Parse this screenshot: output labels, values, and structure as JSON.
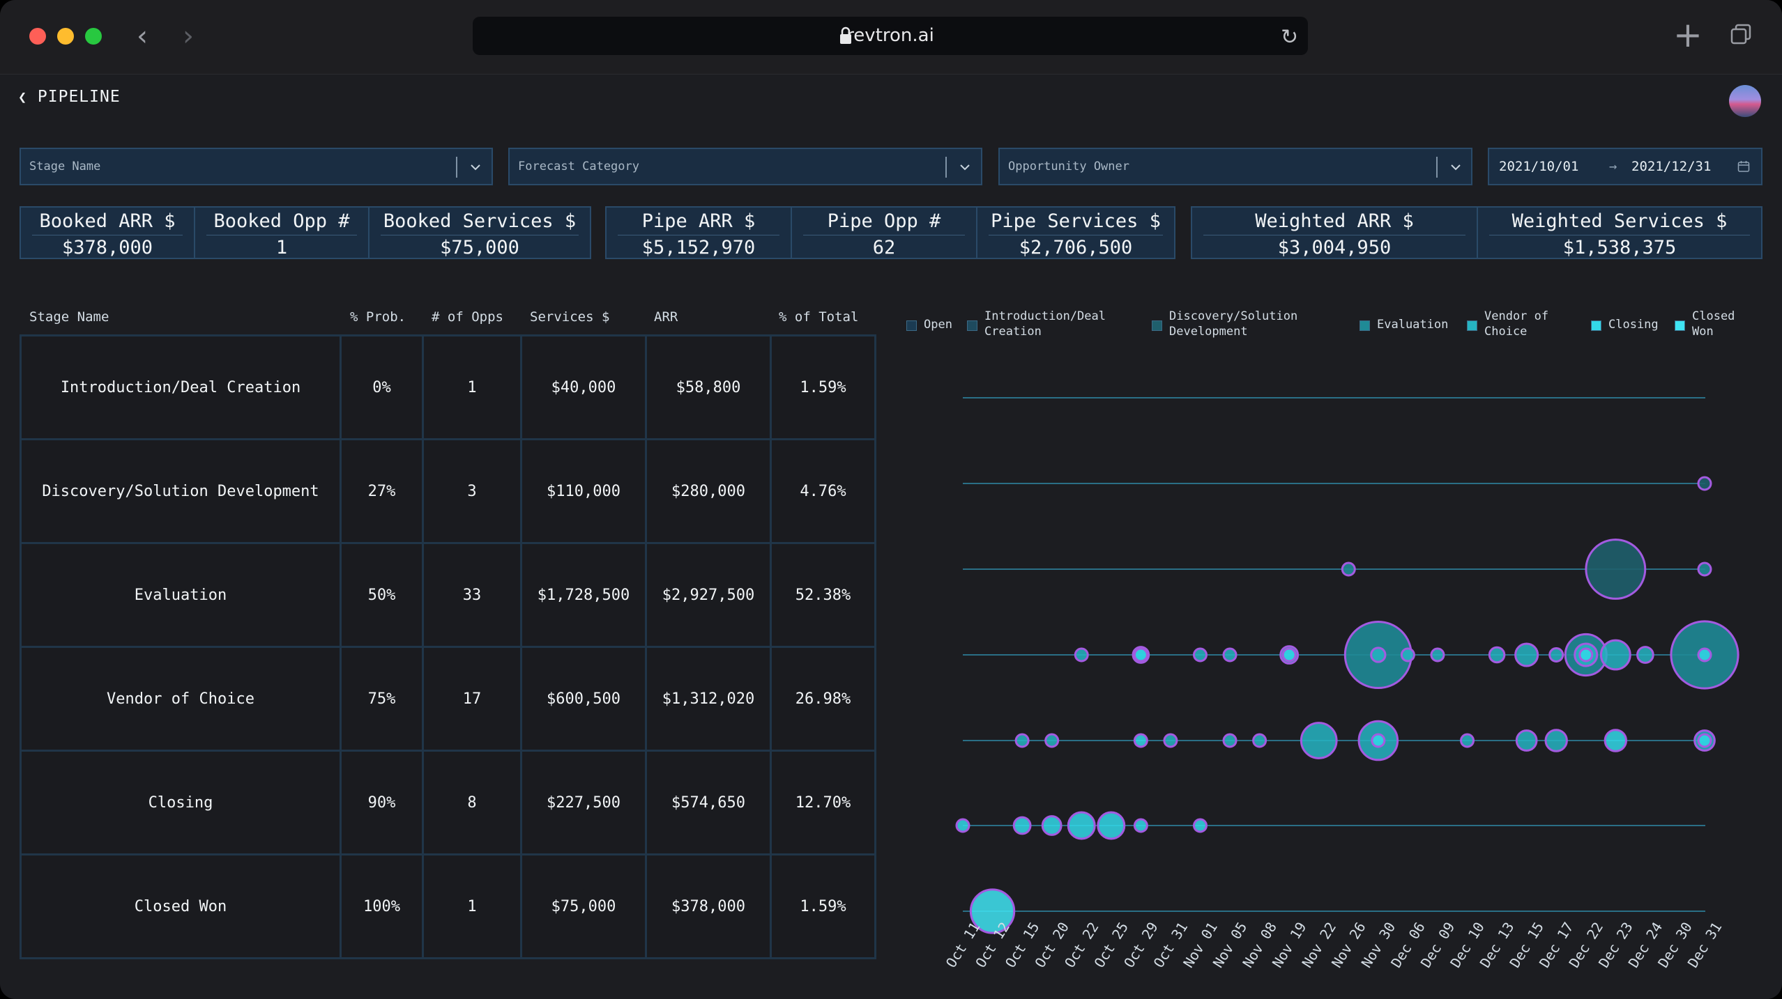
{
  "browser": {
    "url": "revtron.ai"
  },
  "header": {
    "back_label": "PIPELINE"
  },
  "filters": {
    "stage_name_placeholder": "Stage Name",
    "forecast_category_placeholder": "Forecast Category",
    "opportunity_owner_placeholder": "Opportunity Owner",
    "date_from": "2021/10/01",
    "date_arrow": "→",
    "date_to": "2021/12/31"
  },
  "kpis": [
    {
      "label": "Booked ARR $",
      "value": "$378,000"
    },
    {
      "label": "Booked Opp #",
      "value": "1"
    },
    {
      "label": "Booked Services $",
      "value": "$75,000"
    },
    {
      "label": "Pipe ARR $",
      "value": "$5,152,970"
    },
    {
      "label": "Pipe Opp #",
      "value": "62"
    },
    {
      "label": "Pipe Services $",
      "value": "$2,706,500"
    },
    {
      "label": "Weighted ARR $",
      "value": "$3,004,950"
    },
    {
      "label": "Weighted Services $",
      "value": "$1,538,375"
    }
  ],
  "table": {
    "headers": [
      "Stage Name",
      "% Prob.",
      "# of Opps",
      "Services $",
      "ARR",
      "% of Total"
    ],
    "rows": [
      [
        "Introduction/Deal Creation",
        "0%",
        "1",
        "$40,000",
        "$58,800",
        "1.59%"
      ],
      [
        "Discovery/Solution Development",
        "27%",
        "3",
        "$110,000",
        "$280,000",
        "4.76%"
      ],
      [
        "Evaluation",
        "50%",
        "33",
        "$1,728,500",
        "$2,927,500",
        "52.38%"
      ],
      [
        "Vendor of Choice",
        "75%",
        "17",
        "$600,500",
        "$1,312,020",
        "26.98%"
      ],
      [
        "Closing",
        "90%",
        "8",
        "$227,500",
        "$574,650",
        "12.70%"
      ],
      [
        "Closed Won",
        "100%",
        "1",
        "$75,000",
        "$378,000",
        "1.59%"
      ]
    ]
  },
  "colors": {
    "open": "#1b3b52",
    "intro": "#1e4a5e",
    "discovery": "#1f5f6c",
    "evaluation": "#1f8a96",
    "vendor": "#26b4c2",
    "closing": "#33d8e8",
    "closed_won": "#3fe4f2",
    "bubble_stroke": "#a35be0"
  },
  "chart_data": {
    "type": "scatter",
    "legend": [
      {
        "name": "Open",
        "color": "#1b3b52"
      },
      {
        "name": "Introduction/Deal\nCreation",
        "color": "#1e4a5e"
      },
      {
        "name": "Discovery/Solution\nDevelopment",
        "color": "#1f5f6c"
      },
      {
        "name": "Evaluation",
        "color": "#1f8a96"
      },
      {
        "name": "Vendor of\nChoice",
        "color": "#26b4c2"
      },
      {
        "name": "Closing",
        "color": "#33d8e8"
      },
      {
        "name": "Closed\nWon",
        "color": "#3fe4f2"
      }
    ],
    "x_dates": [
      "Oct 11",
      "Oct 12",
      "Oct 15",
      "Oct 20",
      "Oct 22",
      "Oct 25",
      "Oct 29",
      "Oct 31",
      "Nov 01",
      "Nov 05",
      "Nov 08",
      "Nov 19",
      "Nov 22",
      "Nov 26",
      "Nov 30",
      "Dec 06",
      "Dec 09",
      "Dec 10",
      "Dec 13",
      "Dec 15",
      "Dec 17",
      "Dec 22",
      "Dec 23",
      "Dec 24",
      "Dec 30",
      "Dec 31"
    ],
    "rows": [
      "Introduction/Deal Creation",
      "Discovery/Solution Development",
      "Evaluation",
      "Vendor of Choice",
      "Closing",
      "Closed Won"
    ],
    "points": [
      {
        "row": 1,
        "x": 25,
        "size": 30000,
        "series": 2
      },
      {
        "row": 2,
        "x": 13,
        "size": 25000,
        "series": 3
      },
      {
        "row": 2,
        "x": 22,
        "size": 700000,
        "series": 2
      },
      {
        "row": 2,
        "x": 25,
        "size": 25000,
        "series": 3
      },
      {
        "row": 3,
        "x": 4,
        "size": 30000,
        "series": 4
      },
      {
        "row": 3,
        "x": 6,
        "size": 50000,
        "series": 4
      },
      {
        "row": 3,
        "x": 6,
        "size": 20000,
        "series": 5
      },
      {
        "row": 3,
        "x": 8,
        "size": 30000,
        "series": 4
      },
      {
        "row": 3,
        "x": 9,
        "size": 25000,
        "series": 4
      },
      {
        "row": 3,
        "x": 11,
        "size": 60000,
        "series": 4
      },
      {
        "row": 3,
        "x": 11,
        "size": 25000,
        "series": 5
      },
      {
        "row": 3,
        "x": 14,
        "size": 880000,
        "series": 3
      },
      {
        "row": 3,
        "x": 14,
        "size": 40000,
        "series": 4
      },
      {
        "row": 3,
        "x": 15,
        "size": 30000,
        "series": 4
      },
      {
        "row": 3,
        "x": 16,
        "size": 10000,
        "series": 4
      },
      {
        "row": 3,
        "x": 18,
        "size": 45000,
        "series": 4
      },
      {
        "row": 3,
        "x": 19,
        "size": 100000,
        "series": 4
      },
      {
        "row": 3,
        "x": 20,
        "size": 35000,
        "series": 4
      },
      {
        "row": 3,
        "x": 21,
        "size": 340000,
        "series": 3
      },
      {
        "row": 3,
        "x": 21,
        "size": 100000,
        "series": 4
      },
      {
        "row": 3,
        "x": 21,
        "size": 20000,
        "series": 5
      },
      {
        "row": 3,
        "x": 22,
        "size": 170000,
        "series": 4
      },
      {
        "row": 3,
        "x": 23,
        "size": 50000,
        "series": 4
      },
      {
        "row": 3,
        "x": 25,
        "size": 900000,
        "series": 3
      },
      {
        "row": 3,
        "x": 25,
        "size": 30000,
        "series": 5
      },
      {
        "row": 4,
        "x": 2,
        "size": 30000,
        "series": 4
      },
      {
        "row": 4,
        "x": 3,
        "size": 25000,
        "series": 4
      },
      {
        "row": 4,
        "x": 6,
        "size": 25000,
        "series": 5
      },
      {
        "row": 4,
        "x": 7,
        "size": 25000,
        "series": 4
      },
      {
        "row": 4,
        "x": 9,
        "size": 10000,
        "series": 4
      },
      {
        "row": 4,
        "x": 10,
        "size": 25000,
        "series": 4
      },
      {
        "row": 4,
        "x": 12,
        "size": 250000,
        "series": 4
      },
      {
        "row": 4,
        "x": 14,
        "size": 300000,
        "series": 4
      },
      {
        "row": 4,
        "x": 14,
        "size": 15000,
        "series": 5
      },
      {
        "row": 4,
        "x": 17,
        "size": 25000,
        "series": 4
      },
      {
        "row": 4,
        "x": 19,
        "size": 80000,
        "series": 4
      },
      {
        "row": 4,
        "x": 20,
        "size": 90000,
        "series": 4
      },
      {
        "row": 4,
        "x": 22,
        "size": 90000,
        "series": 5
      },
      {
        "row": 4,
        "x": 25,
        "size": 80000,
        "series": 4
      },
      {
        "row": 4,
        "x": 25,
        "size": 25000,
        "series": 5
      },
      {
        "row": 5,
        "x": 0,
        "size": 30000,
        "series": 5
      },
      {
        "row": 5,
        "x": 2,
        "size": 55000,
        "series": 5
      },
      {
        "row": 5,
        "x": 3,
        "size": 70000,
        "series": 5
      },
      {
        "row": 5,
        "x": 4,
        "size": 140000,
        "series": 5
      },
      {
        "row": 5,
        "x": 5,
        "size": 140000,
        "series": 5
      },
      {
        "row": 5,
        "x": 6,
        "size": 30000,
        "series": 5
      },
      {
        "row": 5,
        "x": 8,
        "size": 30000,
        "series": 5
      },
      {
        "row": 6,
        "x": 1,
        "size": 378000,
        "series": 6
      }
    ]
  }
}
